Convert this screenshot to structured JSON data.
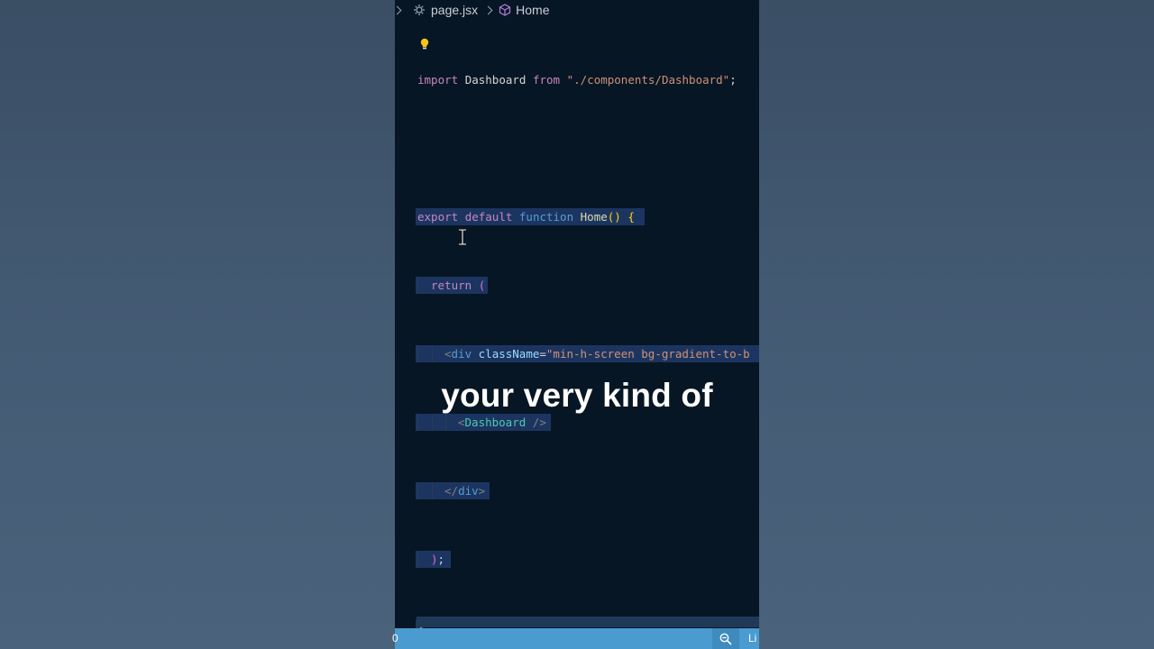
{
  "breadcrumb": {
    "file": "page.jsx",
    "symbol": "Home",
    "file_icon": "react-gear-icon",
    "symbol_icon": "cube-icon"
  },
  "code": {
    "line1": {
      "import_kw": "import",
      "name": "Dashboard",
      "from_kw": "from",
      "path": "\"./components/Dashboard\"",
      "semi": ";"
    },
    "line3": {
      "export_kw": "export",
      "default_kw": "default",
      "function_kw": "function",
      "fn_name": "Home",
      "parens": "()",
      "brace": "{"
    },
    "line4": {
      "return_kw": "return",
      "paren": "("
    },
    "line5": {
      "open": "<",
      "tag": "div",
      "attr": "className",
      "eq": "=",
      "value": "\"min-h-screen bg-gradient-to-b"
    },
    "line6": {
      "open": "<",
      "component": "Dashboard",
      "close": " />"
    },
    "line7": {
      "open": "</",
      "tag": "div",
      "close": ">"
    },
    "line8": {
      "paren": ")",
      "semi": ";"
    },
    "line9": {
      "brace": "}"
    }
  },
  "caption": "your very kind of",
  "statusbar": {
    "left_text": "0",
    "zoom_icon": "zoom-out-icon",
    "right_text": "Li"
  },
  "colors": {
    "editor_bg": "#071624",
    "selection": "#1c3560",
    "statusbar": "#4a9bd0",
    "page_bg": "#3f5368"
  }
}
